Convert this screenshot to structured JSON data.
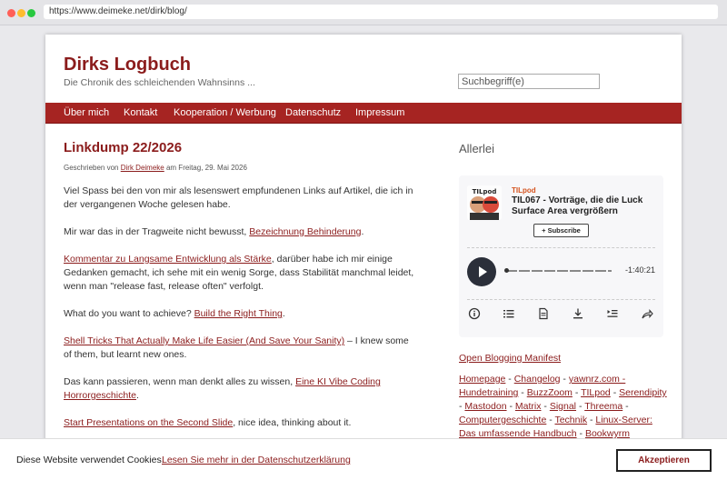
{
  "browser": {
    "url": "https://www.deimeke.net/dirk/blog/"
  },
  "site": {
    "title": "Dirks Logbuch",
    "description": "Die Chronik des schleichenden Wahnsinns ...",
    "search_placeholder": "Suchbegriff(e)"
  },
  "nav": [
    "Über mich",
    "Kontakt",
    "Kooperation / Werbung",
    "Datenschutz",
    "Impressum"
  ],
  "post": {
    "title": "Linkdump 22/2026",
    "meta_prefix": "Geschrieben von",
    "author": "Dirk Deimeke",
    "meta_suffix": "am Freitag, 29. Mai 2026",
    "p1": "Viel Spass bei den von mir als lesenswert empfundenen Links auf Artikel, die ich in der vergangenen Woche gelesen habe.",
    "p2_text": "Mir war das in der Tragweite nicht bewusst,",
    "p2_link": "Bezeichnung Behinderung",
    "p2_end": ".",
    "p3_link": "Kommentar zu Langsame Entwicklung als Stärke",
    "p3_text": ", darüber habe ich mir einige Gedanken gemacht, ich sehe mit ein wenig Sorge, dass Stabilität manchmal leidet, wenn man \"release fast, release often\" verfolgt.",
    "p4_text": "What do you want to achieve?",
    "p4_link": "Build the Right Thing",
    "p4_end": ".",
    "p5_link": "Shell Tricks That Actually Make Life Easier (And Save Your Sanity)",
    "p5_text": " – I knew some of them, but learnt new ones.",
    "p6_text": "Das kann passieren, wenn man denkt alles zu wissen,",
    "p6_link": "Eine KI Vibe Coding Horrorgeschichte",
    "p6_end": ".",
    "p7_link": "Start Presentations on the Second Slide",
    "p7_text": ", nice idea, thinking about it."
  },
  "sidebar": {
    "heading": "Allerlei",
    "player": {
      "podcast": "TILpod",
      "episode": "TIL067 - Vorträge, die die Luck Surface Area vergrößern",
      "subscribe": "Subscribe",
      "time": "-1:40:21"
    },
    "manifest_link": "Open Blogging Manifest",
    "links": [
      "Homepage",
      "Changelog",
      "yawnrz.com - Hundetraining",
      "BuzzZoom",
      "TILpod",
      "Serendipity",
      "Mastodon",
      "Matrix",
      "Signal",
      "Threema",
      "Computergeschichte",
      "Technik",
      "Linux-Server: Das umfassende Handbuch",
      "Bookwyrm"
    ],
    "separator": " - "
  },
  "cookie": {
    "text": "Diese Website verwendet Cookies.",
    "link": "Lesen Sie mehr in der Datenschutzerklärung",
    "accept": "Akzeptieren"
  },
  "colors": {
    "brand": "#8b1c1c",
    "nav": "#a62422",
    "podcast": "#d5531e"
  }
}
